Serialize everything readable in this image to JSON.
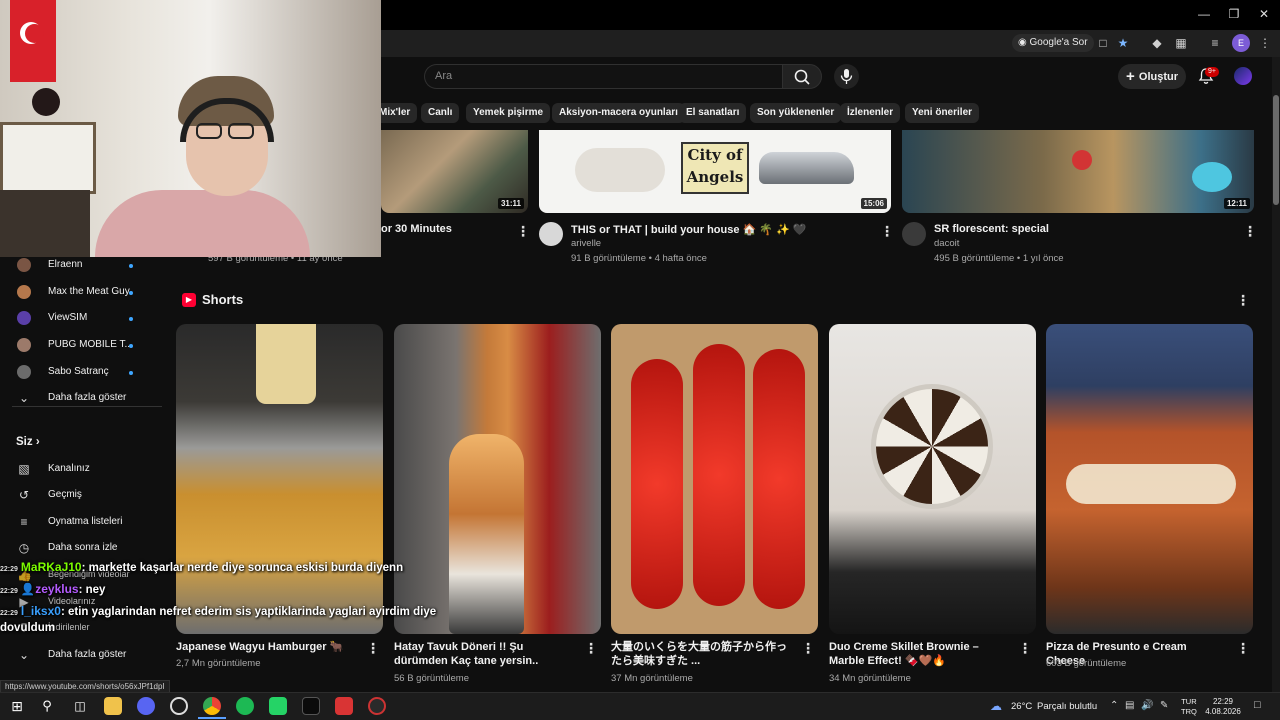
{
  "browser": {
    "google_sor": "Google'a Sor"
  },
  "header": {
    "search_placeholder": "Ara",
    "create_label": "Oluştur",
    "notifications_count": "9+"
  },
  "chips": [
    "Mix'ler",
    "Canlı",
    "Yemek pişirme",
    "Aksiyon-macera oyunları",
    "El sanatları",
    "Son yüklenenler",
    "İzlenenler",
    "Yeni öneriler"
  ],
  "videos": [
    {
      "title": "or 30 Minutes",
      "channel": "",
      "meta": "597 B görüntüleme • 11 ay önce",
      "duration": "31:11"
    },
    {
      "title": "THIS or THAT | build your house 🏠 🌴 ✨ 🖤",
      "channel": "arivelle",
      "meta": "91 B görüntüleme • 4 hafta önce",
      "duration": "15:06",
      "thumb_text": "City of Angels"
    },
    {
      "title": "SR florescent: special",
      "channel": "dacoit",
      "meta": "495 B görüntüleme • 1 yıl önce",
      "duration": "12:11"
    }
  ],
  "sidebar": {
    "subscriptions": [
      {
        "label": "Elraenn"
      },
      {
        "label": "Max the Meat Guy"
      },
      {
        "label": "ViewSIM"
      },
      {
        "label": "PUBG MOBILE T..."
      },
      {
        "label": "Sabo Satranç"
      }
    ],
    "show_more_1": "Daha fazla göster",
    "you_heading": "Siz",
    "you_items": [
      {
        "label": "Kanalınız",
        "icon": "channel-icon"
      },
      {
        "label": "Geçmiş",
        "icon": "history-icon"
      },
      {
        "label": "Oynatma listeleri",
        "icon": "playlist-icon"
      },
      {
        "label": "Daha sonra izle",
        "icon": "clock-icon"
      },
      {
        "label": "Beğendiğim videolar",
        "icon": "like-icon"
      },
      {
        "label": "Videolarınız",
        "icon": "video-icon"
      },
      {
        "label": "İndirilenler",
        "icon": "download-icon"
      }
    ],
    "show_more_2": "Daha fazla göster"
  },
  "shorts": {
    "heading": "Shorts",
    "items": [
      {
        "title": "Japanese Wagyu Hamburger 🐂",
        "views": "2,7 Mn görüntüleme"
      },
      {
        "title": "Hatay Tavuk Döneri !! Şu dürümden Kaç tane yersin..",
        "views": "56 B görüntüleme"
      },
      {
        "title": "大量のいくらを大量の筋子から作ったら美味すぎた ...",
        "views": "37 Mn görüntüleme"
      },
      {
        "title": "Duo Creme Skillet Brownie – Marble Effect! 🍫🤎🔥",
        "views": "34 Mn görüntüleme"
      },
      {
        "title": "Pizza de Presunto e Cream Cheese",
        "views": "603 B görüntüleme"
      }
    ]
  },
  "chat": [
    {
      "time": "22:29",
      "user": "MaRKaJ10",
      "user_color": "#7cfc00",
      "message": ": markette kaşarlar nerde diye sorunca eskisi burda diyenn"
    },
    {
      "time": "22:29",
      "user": "zeyklus",
      "user_color": "#b55cff",
      "message": ": ney"
    },
    {
      "time": "22:29",
      "user": "l_iksx0",
      "user_color": "#3aa0ff",
      "message": ": etin yaglarindan nefret ederim sis yaptiklarinda yaglari ayirdim diye"
    },
    {
      "time": "",
      "user": "",
      "user_color": "#ffffff",
      "message": "dovuldum"
    }
  ],
  "status_url": "https://www.youtube.com/shorts/o56xJPf1dpI",
  "taskbar": {
    "weather_temp": "26°C",
    "weather_text": "Parçalı bulutlu",
    "lang_top": "TUR",
    "lang_bottom": "TRQ",
    "time": "22:29",
    "date": "4.08.2026"
  }
}
